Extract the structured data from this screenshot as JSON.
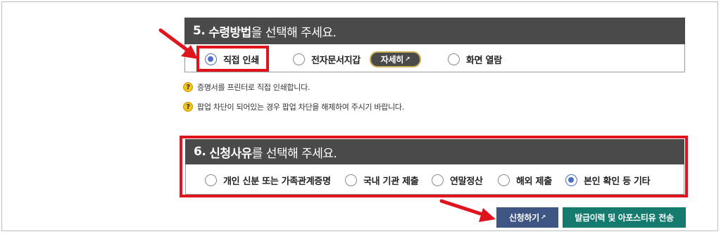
{
  "section5": {
    "number": "5.",
    "title_bold": "수령방법",
    "title_rest": "을 선택해 주세요.",
    "options": [
      {
        "label": "직접 인쇄",
        "checked": true
      },
      {
        "label": "전자문서지갑",
        "checked": false
      },
      {
        "label": "화면 열람",
        "checked": false
      }
    ],
    "detail_button": "자세히",
    "notes": [
      "증명서를 프린터로 직접 인쇄합니다.",
      "팝업 차단이 되어있는 경우 팝업 차단을 해제하여 주시기 바랍니다."
    ]
  },
  "section6": {
    "number": "6.",
    "title_bold": "신청사유",
    "title_rest": "를 선택해 주세요.",
    "options": [
      {
        "label": "개인 신분 또는 가족관계증명",
        "checked": false
      },
      {
        "label": "국내 기관 제출",
        "checked": false
      },
      {
        "label": "연말정산",
        "checked": false
      },
      {
        "label": "해외 제출",
        "checked": false
      },
      {
        "label": "본인 확인 등 기타",
        "checked": true
      }
    ]
  },
  "buttons": {
    "apply": "신청하기",
    "history": "발급이력 및 아포스티유 전송"
  },
  "colors": {
    "header_bg": "#4a4a4a",
    "highlight_red": "#e0141c",
    "radio_selected": "#4a6fc5",
    "apply_bg": "#3f5685",
    "history_bg": "#167b6f"
  }
}
